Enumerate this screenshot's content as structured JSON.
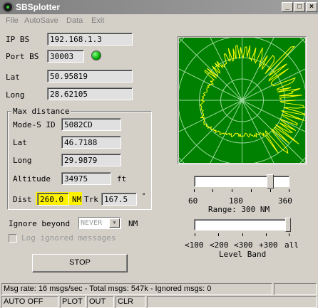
{
  "window": {
    "title": "SBSplotter"
  },
  "menu": [
    "File",
    "AutoSave",
    "Data",
    "Exit"
  ],
  "connection": {
    "ip_label": "IP BS",
    "ip_value": "192.168.1.3",
    "port_label": "Port BS",
    "port_value": "30003",
    "lat_label": "Lat",
    "lat_value": "50.95819",
    "long_label": "Long",
    "long_value": "28.62105"
  },
  "max_distance": {
    "title": "Max distance",
    "modes_label": "Mode-S ID",
    "modes_value": "5082CD",
    "lat_label": "Lat",
    "lat_value": "46.7188",
    "long_label": "Long",
    "long_value": "29.9879",
    "alt_label": "Altitude",
    "alt_value": "34975",
    "alt_unit": "ft",
    "dist_label": "Dist",
    "dist_value": "260.0",
    "dist_unit": "NM",
    "trk_label": "Trk",
    "trk_value": "167.5",
    "deg_symbol": "°"
  },
  "ignore": {
    "label": "Ignore beyond",
    "value": "NEVER",
    "unit": "NM",
    "log_label": "Log ignored messages"
  },
  "stop_label": "STOP",
  "range_slider": {
    "ticks": [
      "60",
      "180",
      "360"
    ],
    "caption": "Range: 300 NM",
    "value_nm": 300
  },
  "level_slider": {
    "ticks": [
      "<100",
      "<200",
      "<300",
      "+300",
      "all"
    ],
    "caption": "Level Band"
  },
  "status": {
    "message": "Msg rate: 16 msgs/sec - Total msgs: 547k - Ignored msgs: 0",
    "panes": [
      "AUTO OFF",
      "PLOT",
      "OUT",
      "CLR"
    ]
  },
  "colors": {
    "radar_bg": "#008000",
    "radar_grid": "#9bd89b",
    "plot": "#ffff00",
    "highlight": "#fff200"
  },
  "icons": {
    "app": "radar-app-icon",
    "status_led": "green-led-icon"
  }
}
